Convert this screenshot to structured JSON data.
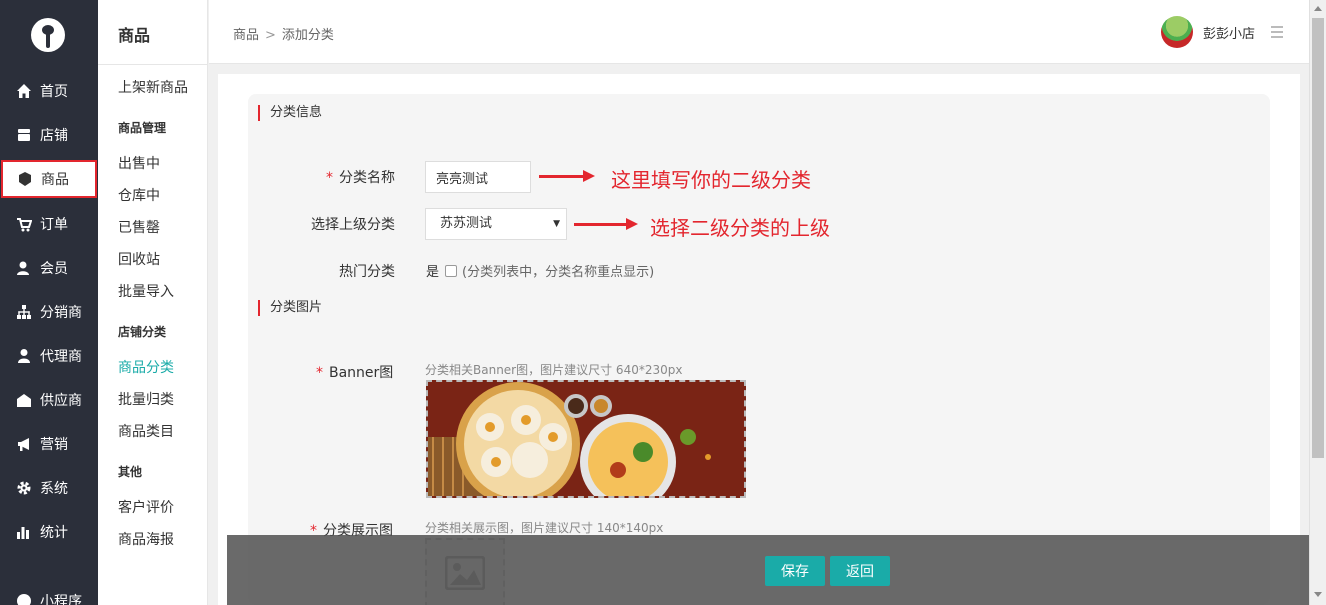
{
  "nav": {
    "items": [
      {
        "label": "首页",
        "icon": "home-icon"
      },
      {
        "label": "店铺",
        "icon": "store-icon"
      },
      {
        "label": "商品",
        "icon": "cube-icon"
      },
      {
        "label": "订单",
        "icon": "cart-icon"
      },
      {
        "label": "会员",
        "icon": "member-icon"
      },
      {
        "label": "分销商",
        "icon": "hierarchy-icon"
      },
      {
        "label": "代理商",
        "icon": "agent-icon"
      },
      {
        "label": "供应商",
        "icon": "building-icon"
      },
      {
        "label": "营销",
        "icon": "bullhorn-icon"
      },
      {
        "label": "系统",
        "icon": "gear-icon"
      },
      {
        "label": "统计",
        "icon": "bar-chart-icon"
      },
      {
        "label": "小程序",
        "icon": "miniapp-icon"
      }
    ]
  },
  "subnav": {
    "title": "商品",
    "top_item": "上架新商品",
    "groups": [
      {
        "title": "商品管理",
        "items": [
          "出售中",
          "仓库中",
          "已售罄",
          "回收站",
          "批量导入"
        ]
      },
      {
        "title": "店铺分类",
        "items": [
          "商品分类",
          "批量归类",
          "商品类目"
        ]
      },
      {
        "title": "其他",
        "items": [
          "客户评价",
          "商品海报"
        ]
      }
    ]
  },
  "topbar": {
    "breadcrumb": [
      "商品",
      "添加分类"
    ],
    "username": "彭彭小店"
  },
  "form": {
    "section_info": "分类信息",
    "name_label": "分类名称",
    "name_value": "亮亮测试",
    "parent_label": "选择上级分类",
    "parent_value": "苏苏测试",
    "hot_label": "热门分类",
    "hot_option": "是",
    "hot_note": "(分类列表中，分类名称重点显示)",
    "section_image": "分类图片",
    "banner_label": "Banner图",
    "banner_hint": "分类相关Banner图，图片建议尺寸 640*230px",
    "display_label": "分类展示图",
    "display_hint": "分类相关展示图，图片建议尺寸 140*140px"
  },
  "annotations": {
    "name_note": "这里填写你的二级分类",
    "parent_note": "选择二级分类的上级"
  },
  "actions": {
    "save": "保存",
    "back": "返回"
  },
  "colors": {
    "nav_bg": "#2b2f3a",
    "accent": "#1aaba8",
    "alert": "#e3262e"
  }
}
